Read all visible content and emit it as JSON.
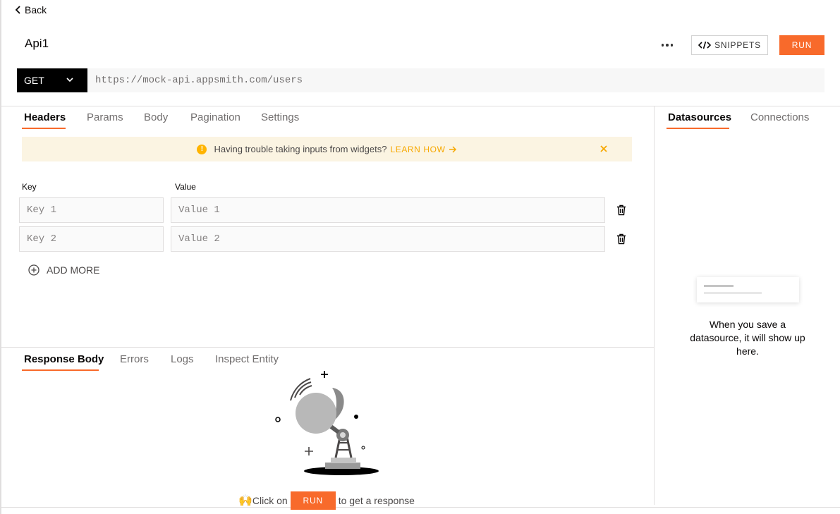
{
  "header": {
    "back_label": "Back",
    "api_name": "Api1",
    "snippets_label": "SNIPPETS",
    "run_label": "RUN"
  },
  "request": {
    "method": "GET",
    "url": "https://mock-api.appsmith.com/users"
  },
  "request_tabs": [
    {
      "label": "Headers",
      "active": true
    },
    {
      "label": "Params",
      "active": false
    },
    {
      "label": "Body",
      "active": false
    },
    {
      "label": "Pagination",
      "active": false
    },
    {
      "label": "Settings",
      "active": false
    }
  ],
  "banner": {
    "text": "Having trouble taking inputs from widgets?",
    "link_label": "LEARN HOW"
  },
  "headers_table": {
    "key_header": "Key",
    "value_header": "Value",
    "rows": [
      {
        "key_placeholder": "Key 1",
        "value_placeholder": "Value 1"
      },
      {
        "key_placeholder": "Key 2",
        "value_placeholder": "Value 2"
      }
    ],
    "add_more_label": "ADD MORE"
  },
  "side_tabs": [
    {
      "label": "Datasources",
      "active": true
    },
    {
      "label": "Connections",
      "active": false
    }
  ],
  "datasources_empty": {
    "text": "When you save a datasource, it will show up here."
  },
  "response_tabs": [
    {
      "label": "Response Body",
      "active": true
    },
    {
      "label": "Errors",
      "active": false
    },
    {
      "label": "Logs",
      "active": false
    },
    {
      "label": "Inspect Entity",
      "active": false
    }
  ],
  "response_empty": {
    "emoji": "🙌",
    "prefix": "Click on",
    "run_label": "RUN",
    "suffix": "to get a response"
  },
  "colors": {
    "accent": "#f86a2b",
    "banner_bg": "#fbf4e2",
    "warning": "#ffb400"
  }
}
